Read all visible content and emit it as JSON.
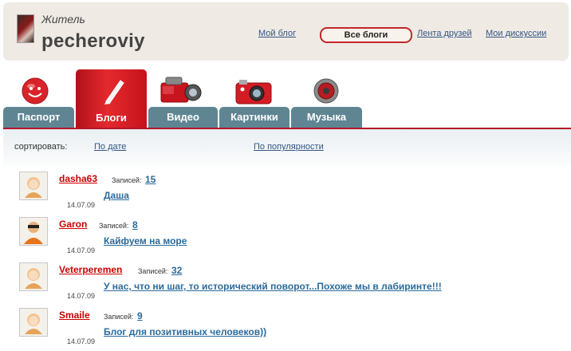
{
  "profile": {
    "role": "Житель",
    "username": "pecheroviy"
  },
  "topnav": {
    "my_blog": "Мой блог",
    "all_blogs": "Все блоги",
    "friends_feed": "Лента друзей",
    "my_discussions": "Мои дискуссии"
  },
  "tabs": [
    {
      "label": "Паспорт",
      "icon": "smiley-icon",
      "active": false
    },
    {
      "label": "Блоги",
      "icon": "pencil-icon",
      "active": true
    },
    {
      "label": "Видео",
      "icon": "video-camera-icon",
      "active": false
    },
    {
      "label": "Картинки",
      "icon": "photo-camera-icon",
      "active": false
    },
    {
      "label": "Музыка",
      "icon": "speaker-icon",
      "active": false
    }
  ],
  "sort": {
    "label": "сортировать:",
    "by_date": "По дате",
    "by_popularity": "По популярности"
  },
  "count_label": "Записей:",
  "blogs": [
    {
      "author": "dasha63",
      "count": "15",
      "date": "14.07.09",
      "title": "Даша"
    },
    {
      "author": "Garon",
      "count": "8",
      "date": "14.07.09",
      "title": "Кайфуем на море"
    },
    {
      "author": "Veterperemen",
      "count": "32",
      "date": "14.07.09",
      "title": "У нас, что ни шаг, то исторический поворот...Похоже мы в лабиринте!!!"
    },
    {
      "author": "Smaile",
      "count": "9",
      "date": "14.07.09",
      "title": "Блог для позитивных человеков))"
    }
  ],
  "colors": {
    "accent_red": "#c0282b",
    "tab_blue": "#5f8593",
    "link_blue": "#2a6b9c",
    "author_red": "#cc0000"
  }
}
